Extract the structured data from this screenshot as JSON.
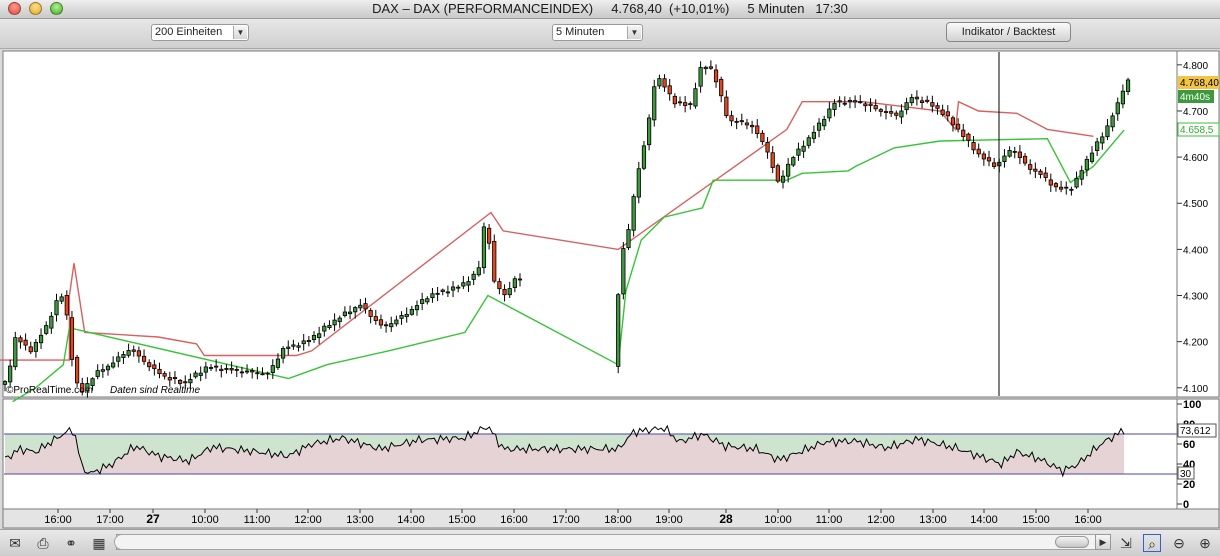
{
  "window": {
    "title": "DAX – DAX (PERFORMANCEINDEX)     4.768,40  (+10,01%)     5 Minuten   17:30"
  },
  "toolbar": {
    "units_select": "200 Einheiten",
    "interval_select": "5 Minuten",
    "indicator_button": "Indikator / Backtest"
  },
  "watermark": {
    "source": "©ProRealTime.com",
    "realtime": "Daten sind Realtime"
  },
  "price_labels": {
    "last": "4.768,40",
    "countdown": "4m40s",
    "stop": "4.658,5"
  },
  "osc_labels": {
    "value": "73,612",
    "lower_level": "30"
  },
  "colors": {
    "up": "#3c9a3c",
    "down": "#e2471c",
    "stop_upper": "#d86060",
    "stop_lower": "#36c436",
    "osc_upper_fill": "#cfe4cf",
    "osc_lower_fill": "#e6d3d5",
    "level_line": "#4a4aaa"
  },
  "chart_data": {
    "type": "candlestick",
    "title": "",
    "price_axis": [
      "4.800",
      "4.700",
      "4.600",
      "4.500",
      "4.400",
      "4.300",
      "4.200",
      "4.100"
    ],
    "price_ylim": [
      4080,
      4830
    ],
    "x_ticks": [
      "16:00",
      "17:00",
      "27",
      "10:00",
      "11:00",
      "12:00",
      "13:00",
      "14:00",
      "15:00",
      "16:00",
      "17:00",
      "18:00",
      "19:00",
      "28",
      "10:00",
      "11:00",
      "12:00",
      "13:00",
      "14:00",
      "15:00",
      "16:00"
    ],
    "price_series": [
      {
        "t": 0,
        "v": 4105
      },
      {
        "t": 0.05,
        "v": 4115
      },
      {
        "t": 0.1,
        "v": 4210
      },
      {
        "t": 0.2,
        "v": 4180
      },
      {
        "t": 0.3,
        "v": 4230
      },
      {
        "t": 0.38,
        "v": 4295
      },
      {
        "t": 0.42,
        "v": 4300
      },
      {
        "t": 0.48,
        "v": 4140
      },
      {
        "t": 0.52,
        "v": 4085
      },
      {
        "t": 0.62,
        "v": 4130
      },
      {
        "t": 0.72,
        "v": 4150
      },
      {
        "t": 0.85,
        "v": 4185
      },
      {
        "t": 1.0,
        "v": 4140
      },
      {
        "t": 1.1,
        "v": 4120
      },
      {
        "t": 1.2,
        "v": 4110
      },
      {
        "t": 1.35,
        "v": 4145
      },
      {
        "t": 1.6,
        "v": 4135
      },
      {
        "t": 1.75,
        "v": 4130
      },
      {
        "t": 1.85,
        "v": 4185
      },
      {
        "t": 2.0,
        "v": 4200
      },
      {
        "t": 2.2,
        "v": 4250
      },
      {
        "t": 2.35,
        "v": 4280
      },
      {
        "t": 2.5,
        "v": 4230
      },
      {
        "t": 2.65,
        "v": 4260
      },
      {
        "t": 2.8,
        "v": 4300
      },
      {
        "t": 3.0,
        "v": 4320
      },
      {
        "t": 3.12,
        "v": 4350
      },
      {
        "t": 3.17,
        "v": 4480
      },
      {
        "t": 3.22,
        "v": 4330
      },
      {
        "t": 3.3,
        "v": 4300
      },
      {
        "t": 3.36,
        "v": 4335
      },
      {
        "t": 4.0,
        "v": 4150
      },
      {
        "t": 4.05,
        "v": 4380
      },
      {
        "t": 4.1,
        "v": 4440
      },
      {
        "t": 4.15,
        "v": 4550
      },
      {
        "t": 4.22,
        "v": 4650
      },
      {
        "t": 4.28,
        "v": 4780
      },
      {
        "t": 4.4,
        "v": 4720
      },
      {
        "t": 4.5,
        "v": 4710
      },
      {
        "t": 4.58,
        "v": 4800
      },
      {
        "t": 4.65,
        "v": 4790
      },
      {
        "t": 4.75,
        "v": 4680
      },
      {
        "t": 4.9,
        "v": 4670
      },
      {
        "t": 5.0,
        "v": 4620
      },
      {
        "t": 5.08,
        "v": 4540
      },
      {
        "t": 5.15,
        "v": 4590
      },
      {
        "t": 5.3,
        "v": 4650
      },
      {
        "t": 5.45,
        "v": 4720
      },
      {
        "t": 5.6,
        "v": 4720
      },
      {
        "t": 5.75,
        "v": 4700
      },
      {
        "t": 5.85,
        "v": 4690
      },
      {
        "t": 5.95,
        "v": 4730
      },
      {
        "t": 6.1,
        "v": 4710
      },
      {
        "t": 6.2,
        "v": 4680
      },
      {
        "t": 6.3,
        "v": 4640
      },
      {
        "t": 6.4,
        "v": 4600
      },
      {
        "t": 6.5,
        "v": 4580
      },
      {
        "t": 6.6,
        "v": 4620
      },
      {
        "t": 6.7,
        "v": 4580
      },
      {
        "t": 6.8,
        "v": 4560
      },
      {
        "t": 6.9,
        "v": 4530
      },
      {
        "t": 7.0,
        "v": 4535
      },
      {
        "t": 7.1,
        "v": 4600
      },
      {
        "t": 7.2,
        "v": 4650
      },
      {
        "t": 7.3,
        "v": 4720
      },
      {
        "t": 7.35,
        "v": 4768
      }
    ],
    "stop_upper": [
      {
        "t": -0.5,
        "v": 4160
      },
      {
        "t": 0.42,
        "v": 4160
      },
      {
        "t": 0.42,
        "v": 4300
      },
      {
        "t": 0.45,
        "v": 4370
      },
      {
        "t": 0.52,
        "v": 4220
      },
      {
        "t": 1.0,
        "v": 4210
      },
      {
        "t": 1.25,
        "v": 4195
      },
      {
        "t": 1.3,
        "v": 4170
      },
      {
        "t": 1.9,
        "v": 4170
      },
      {
        "t": 2.0,
        "v": 4180
      },
      {
        "t": 3.17,
        "v": 4480
      },
      {
        "t": 3.25,
        "v": 4440
      },
      {
        "t": 4.0,
        "v": 4400
      },
      {
        "t": 4.0,
        "v": 4400
      },
      {
        "t": 5.1,
        "v": 4660
      },
      {
        "t": 5.2,
        "v": 4720
      },
      {
        "t": 5.6,
        "v": 4720
      },
      {
        "t": 6.1,
        "v": 4700
      },
      {
        "t": 6.2,
        "v": 4660
      },
      {
        "t": 6.22,
        "v": 4720
      },
      {
        "t": 6.35,
        "v": 4700
      },
      {
        "t": 6.6,
        "v": 4695
      },
      {
        "t": 6.8,
        "v": 4660
      },
      {
        "t": 7.1,
        "v": 4645
      }
    ],
    "stop_lower": [
      {
        "t": 0.05,
        "v": 4070
      },
      {
        "t": 0.2,
        "v": 4100
      },
      {
        "t": 0.38,
        "v": 4150
      },
      {
        "t": 0.42,
        "v": 4230
      },
      {
        "t": 0.42,
        "v": 4230
      },
      {
        "t": 1.85,
        "v": 4120
      },
      {
        "t": 2.1,
        "v": 4150
      },
      {
        "t": 2.5,
        "v": 4180
      },
      {
        "t": 3.0,
        "v": 4220
      },
      {
        "t": 3.15,
        "v": 4300
      },
      {
        "t": 4.0,
        "v": 4150
      },
      {
        "t": 4.05,
        "v": 4310
      },
      {
        "t": 4.15,
        "v": 4420
      },
      {
        "t": 4.3,
        "v": 4470
      },
      {
        "t": 4.55,
        "v": 4490
      },
      {
        "t": 4.62,
        "v": 4550
      },
      {
        "t": 5.1,
        "v": 4550
      },
      {
        "t": 5.2,
        "v": 4565
      },
      {
        "t": 5.5,
        "v": 4570
      },
      {
        "t": 5.55,
        "v": 4580
      },
      {
        "t": 5.8,
        "v": 4620
      },
      {
        "t": 6.1,
        "v": 4635
      },
      {
        "t": 6.8,
        "v": 4640
      },
      {
        "t": 6.95,
        "v": 4545
      },
      {
        "t": 7.1,
        "v": 4580
      },
      {
        "t": 7.3,
        "v": 4658.5
      }
    ],
    "oscillator": {
      "axis": [
        "100",
        "80",
        "60",
        "40",
        "20",
        "0"
      ],
      "ylim": [
        -5,
        105
      ],
      "upper_level": 70,
      "lower_level": 30,
      "last": 73.612,
      "values": [
        {
          "t": 0,
          "v": 45
        },
        {
          "t": 0.1,
          "v": 55
        },
        {
          "t": 0.2,
          "v": 52
        },
        {
          "t": 0.3,
          "v": 62
        },
        {
          "t": 0.4,
          "v": 72
        },
        {
          "t": 0.45,
          "v": 74
        },
        {
          "t": 0.5,
          "v": 38
        },
        {
          "t": 0.55,
          "v": 30
        },
        {
          "t": 0.7,
          "v": 40
        },
        {
          "t": 0.85,
          "v": 58
        },
        {
          "t": 1.0,
          "v": 48
        },
        {
          "t": 1.2,
          "v": 43
        },
        {
          "t": 1.35,
          "v": 57
        },
        {
          "t": 1.6,
          "v": 53
        },
        {
          "t": 1.85,
          "v": 48
        },
        {
          "t": 2.0,
          "v": 60
        },
        {
          "t": 2.2,
          "v": 66
        },
        {
          "t": 2.45,
          "v": 55
        },
        {
          "t": 2.7,
          "v": 64
        },
        {
          "t": 3.0,
          "v": 66
        },
        {
          "t": 3.15,
          "v": 78
        },
        {
          "t": 3.25,
          "v": 55
        },
        {
          "t": 3.35,
          "v": 55
        },
        {
          "t": 4.0,
          "v": 55
        },
        {
          "t": 4.1,
          "v": 72
        },
        {
          "t": 4.3,
          "v": 76
        },
        {
          "t": 4.4,
          "v": 62
        },
        {
          "t": 4.55,
          "v": 70
        },
        {
          "t": 4.7,
          "v": 58
        },
        {
          "t": 4.9,
          "v": 55
        },
        {
          "t": 5.05,
          "v": 44
        },
        {
          "t": 5.15,
          "v": 50
        },
        {
          "t": 5.35,
          "v": 62
        },
        {
          "t": 5.55,
          "v": 63
        },
        {
          "t": 5.75,
          "v": 56
        },
        {
          "t": 5.95,
          "v": 65
        },
        {
          "t": 6.2,
          "v": 56
        },
        {
          "t": 6.35,
          "v": 48
        },
        {
          "t": 6.5,
          "v": 40
        },
        {
          "t": 6.6,
          "v": 52
        },
        {
          "t": 6.75,
          "v": 45
        },
        {
          "t": 6.9,
          "v": 33
        },
        {
          "t": 7.0,
          "v": 40
        },
        {
          "t": 7.15,
          "v": 60
        },
        {
          "t": 7.3,
          "v": 74
        }
      ]
    }
  }
}
